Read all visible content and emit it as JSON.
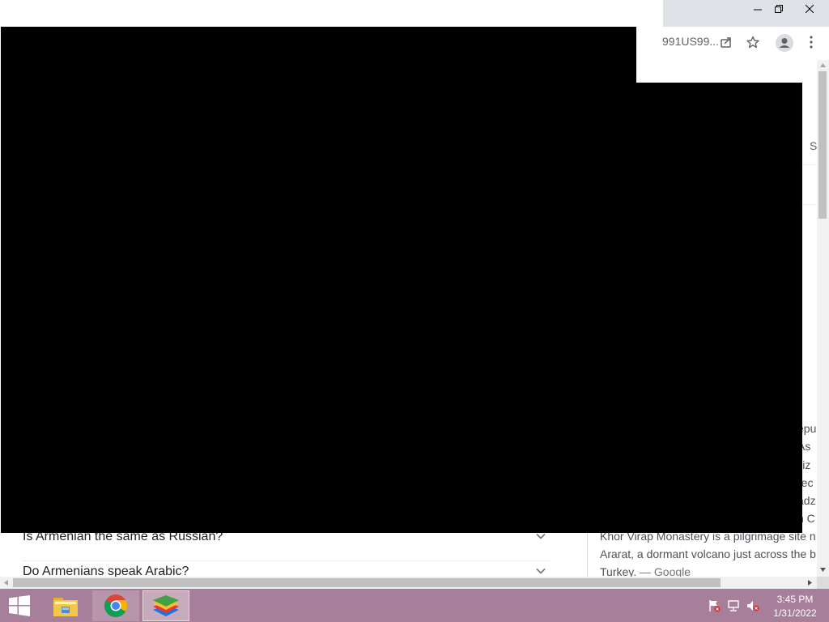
{
  "browser": {
    "omnibox_text": "991US99...",
    "window_buttons": {
      "minimize": "–",
      "restore": "❐",
      "close": "✕"
    }
  },
  "page": {
    "right_column_letter": "S",
    "faq": [
      {
        "question": "Is Armenian the same as Russian?"
      },
      {
        "question": "Do Armenians speak Arabic?"
      }
    ],
    "knowledge_panel": {
      "fragments": [
        "epu",
        "As",
        "iliz",
        "rec",
        "adz",
        "n C"
      ],
      "lines": [
        "Khor Virap Monastery is a pilgrimage site n",
        "Ararat, a dormant volcano just across the b"
      ],
      "last_line_text": "Turkey. ",
      "source": "— Google"
    }
  },
  "taskbar": {
    "apps": [
      "start",
      "file-explorer",
      "google-chrome",
      "bluestacks"
    ],
    "clock": {
      "time": "3:45 PM",
      "date": "1/31/2022"
    }
  },
  "colors": {
    "taskbar": "#a87f9a",
    "titlebar_right": "#dee1e6",
    "redaction": "#000000"
  }
}
